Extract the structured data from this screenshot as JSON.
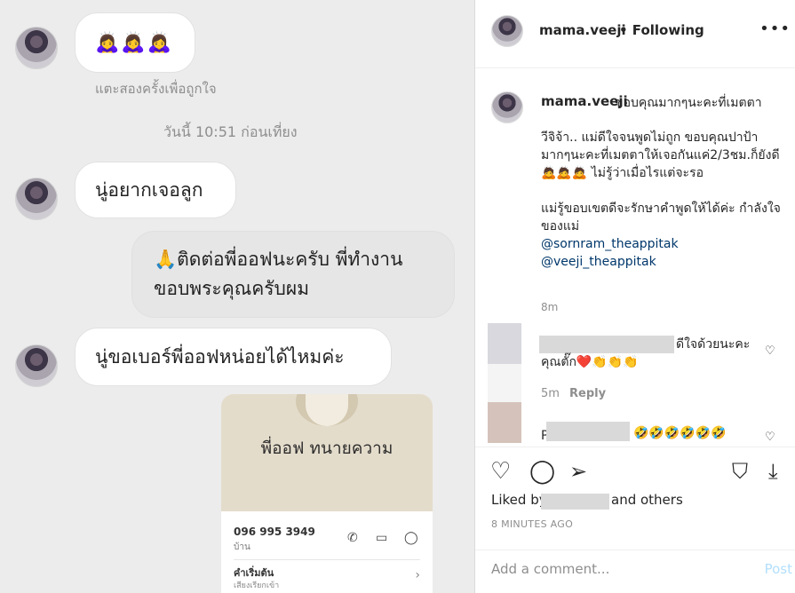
{
  "chat": {
    "reaction_emojis": "🙇‍♀️🙇‍♀️🙇‍♀️",
    "double_tap_hint": "แตะสองครั้งเพื่อถูกใจ",
    "timestamp": "วันนี้ 10:51 ก่อนเที่ยง",
    "messages": [
      {
        "text": "นู่อยากเจอลูก"
      },
      {
        "text": "🙏ติดต่อพี่ออฟนะครับ พี่ทำงานขอบพระคุณครับผม"
      },
      {
        "text": "นู่ขอเบอร์พี่ออฟหน่อยได้ไหมค่ะ"
      }
    ],
    "contact_card": {
      "name": "พี่ออฟ ทนายความ",
      "phone": "096 995 3949",
      "phone_label": "บ้าน",
      "nickname_label": "คำเริ่มต้น",
      "nickname_sub": "เสียงเรียกเข้า"
    }
  },
  "post": {
    "username": "mama.veeji",
    "following_label": "• Following",
    "more_icon": "more-options-icon",
    "caption": {
      "first_line": "ขอบคุณมากๆนะคะที่เมตตา",
      "paragraph1": "วีจิจ้า.. แม่ดีใจจนพูดไม่ถูก ขอบคุณปาป้ามากๆนะคะที่เมตตาให้เจอกันแค่2/3ชม.ก็ยังดี🙇🙇🙇 ไม่รู้ว่าเมื่อไรแต่จะรอ",
      "paragraph2": "แม่รู้ขอบเขตดีจะรักษาคำพูดให้ได้ค่ะ กำลังใจของแม่",
      "mentions": [
        "@sornram_theappitak",
        "@veeji_theappitak"
      ],
      "time": "8m"
    },
    "comments": [
      {
        "text_tail": "ดีใจด้วยนะคะคุณตั๊ก❤️👏👏👏",
        "time": "5m",
        "reply_label": "Reply"
      },
      {
        "text_prefix": "P",
        "text_tail": "🤣🤣🤣🤣🤣🤣"
      }
    ],
    "actions": {
      "liked_by_prefix": "Liked by",
      "liked_by_suffix": "and others",
      "time_ago": "8 MINUTES AGO"
    },
    "comment_box": {
      "placeholder": "Add a comment...",
      "post_label": "Post"
    }
  }
}
